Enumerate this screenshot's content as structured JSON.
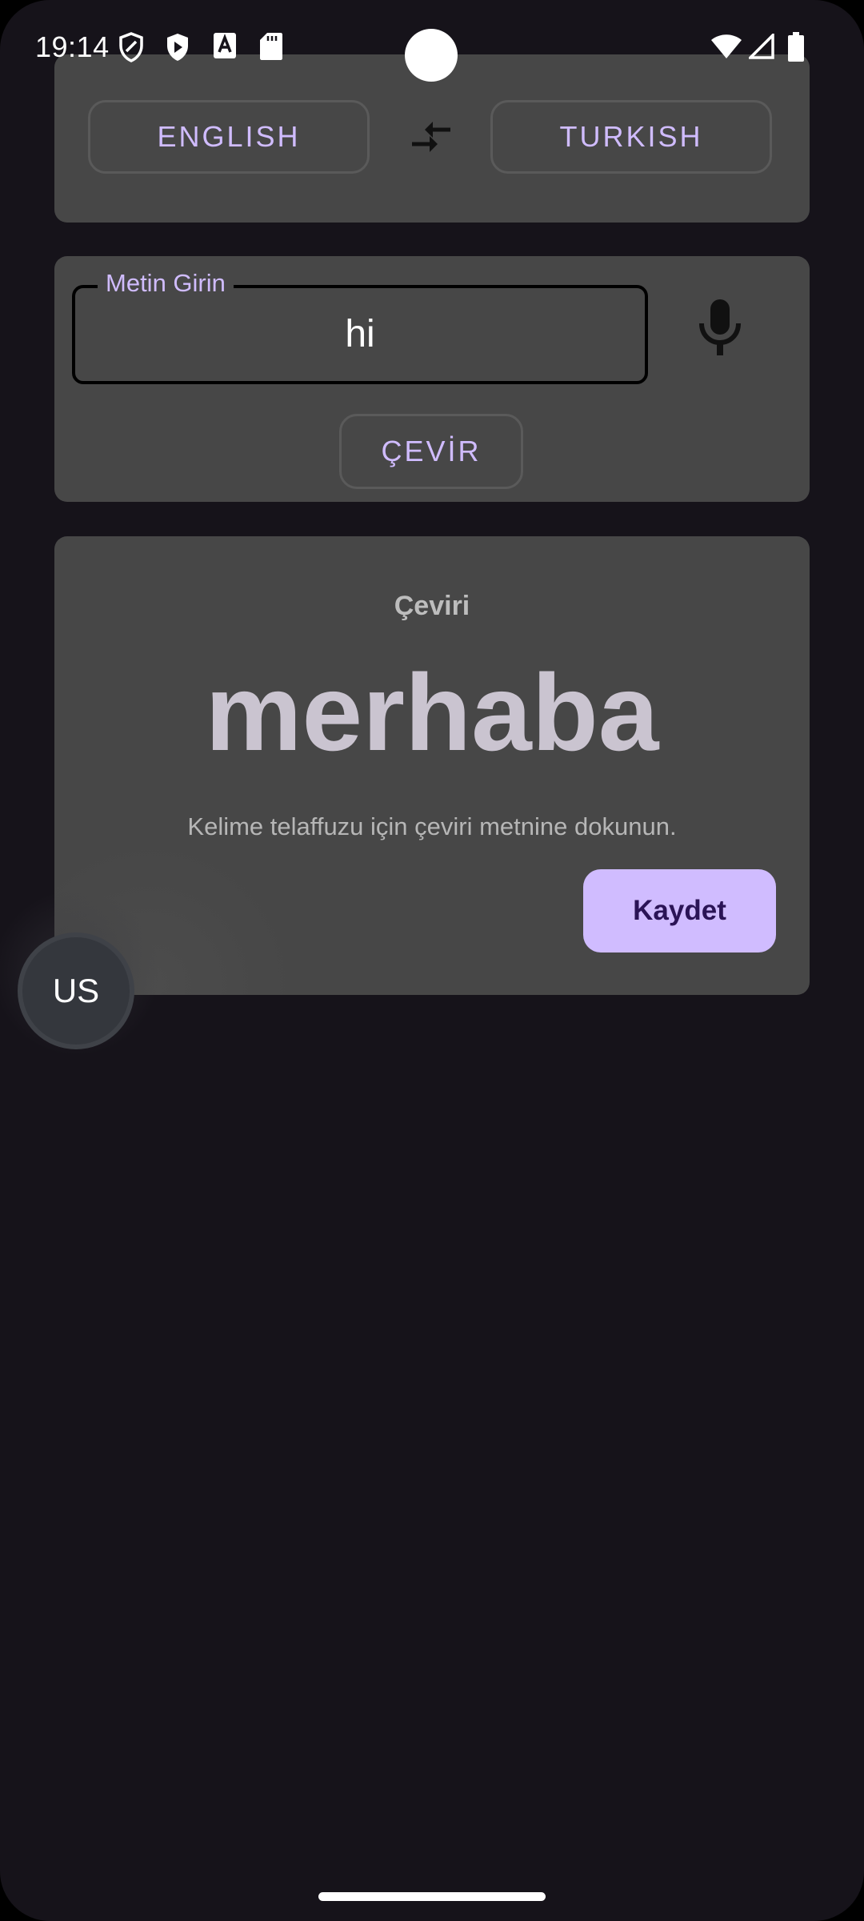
{
  "status_bar": {
    "time": "19:14",
    "left_icons": [
      "shield-outline-icon",
      "shield-play-icon",
      "font-download-icon",
      "sd-card-icon"
    ],
    "right_icons": [
      "wifi-icon",
      "signal-icon",
      "battery-icon"
    ]
  },
  "language_bar": {
    "source_label": "ENGLISH",
    "target_label": "TURKISH",
    "swap_icon": "swap-arrows-icon"
  },
  "input": {
    "label": "Metin Girin",
    "value": "hi",
    "mic_icon": "microphone-icon",
    "translate_label": "ÇEVİR"
  },
  "result": {
    "title": "Çeviri",
    "translation": "merhaba",
    "hint": "Kelime telaffuzu için çeviri metnine dokunun.",
    "save_label": "Kaydet"
  },
  "floating_bubble": {
    "label": "US"
  },
  "colors": {
    "background": "#16131a",
    "card": "#474747",
    "accent": "#d0bcff",
    "accent_text_dark": "#2b1456"
  }
}
